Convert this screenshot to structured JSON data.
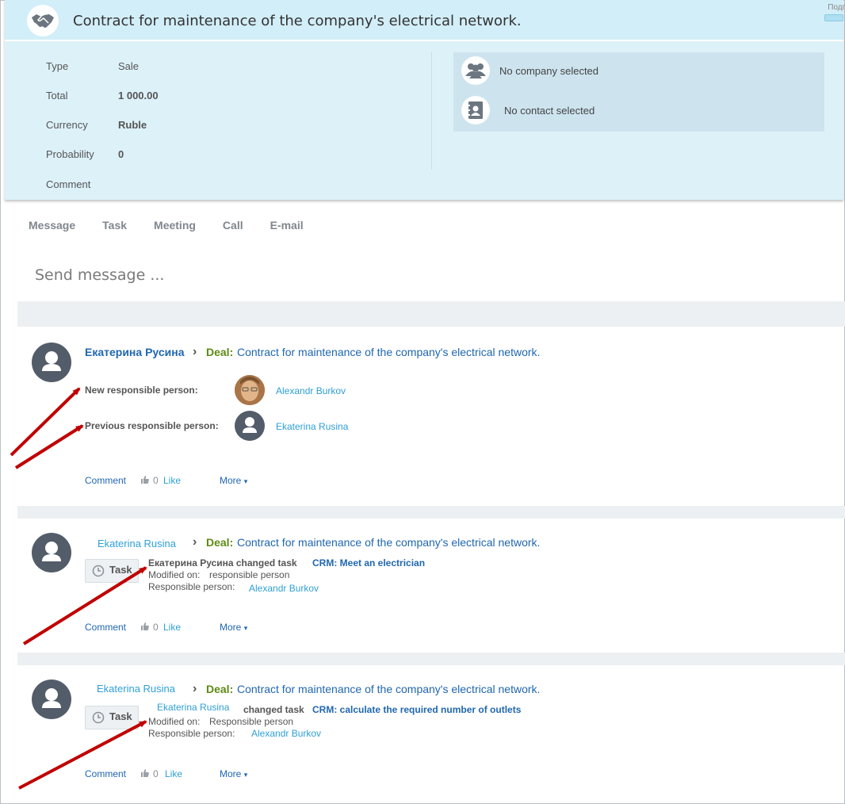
{
  "deal": {
    "title": "Contract for maintenance of the company's electrical network.",
    "corner_label": "Подп",
    "props": [
      {
        "key": "Type",
        "value": "Sale",
        "bold": false
      },
      {
        "key": "Total",
        "value": "1 000.00",
        "bold": true
      },
      {
        "key": "Currency",
        "value": "Ruble",
        "bold": true
      },
      {
        "key": "Probability",
        "value": "0",
        "bold": true
      },
      {
        "key": "Comment",
        "value": "",
        "bold": false
      }
    ],
    "no_company": "No company selected",
    "no_contact": "No contact selected"
  },
  "tabs": [
    "Message",
    "Task",
    "Meeting",
    "Call",
    "E-mail"
  ],
  "composer": {
    "placeholder": "Send message ..."
  },
  "feed": [
    {
      "author": "Екатерина Русина",
      "deal_label": "Deal:",
      "deal_text": "Contract for maintenance of the company's electrical network.",
      "new_label": "New responsible person:",
      "new_name": "Alexandr Burkov",
      "prev_label": "Previous responsible person:",
      "prev_name": "Ekaterina Rusina",
      "comment": "Comment",
      "likes": "0",
      "like": "Like",
      "more": "More"
    },
    {
      "author": "Ekaterina Rusina",
      "deal_label": "Deal:",
      "deal_text": "Contract for maintenance of the company's electrical network.",
      "task_badge": "Task",
      "change_prefix": "Екатерина Русина changed task",
      "task_link": "CRM: Meet an electrician",
      "modified_label": "Modified on:",
      "modified_value": "responsible person",
      "resp_label": "Responsible person:",
      "resp_name": "Alexandr Burkov",
      "comment": "Comment",
      "likes": "0",
      "like": "Like",
      "more": "More"
    },
    {
      "author": "Ekaterina Rusina",
      "deal_label": "Deal:",
      "deal_text": "Contract for maintenance of the company's electrical network.",
      "task_badge": "Task",
      "change_author": "Ekaterina Rusina",
      "change_prefix": "changed task",
      "task_link": "CRM: calculate the required number of outlets",
      "modified_label": "Modified on:",
      "modified_value": "Responsible person",
      "resp_label": "Responsible person:",
      "resp_name": "Alexandr Burkov",
      "comment": "Comment",
      "likes": "0",
      "like": "Like",
      "more": "More"
    }
  ],
  "colors": {
    "card_bg": "#ddf1f9",
    "link": "#2067b0",
    "deal_green": "#5e8a15",
    "arrow_red": "#c00000"
  }
}
